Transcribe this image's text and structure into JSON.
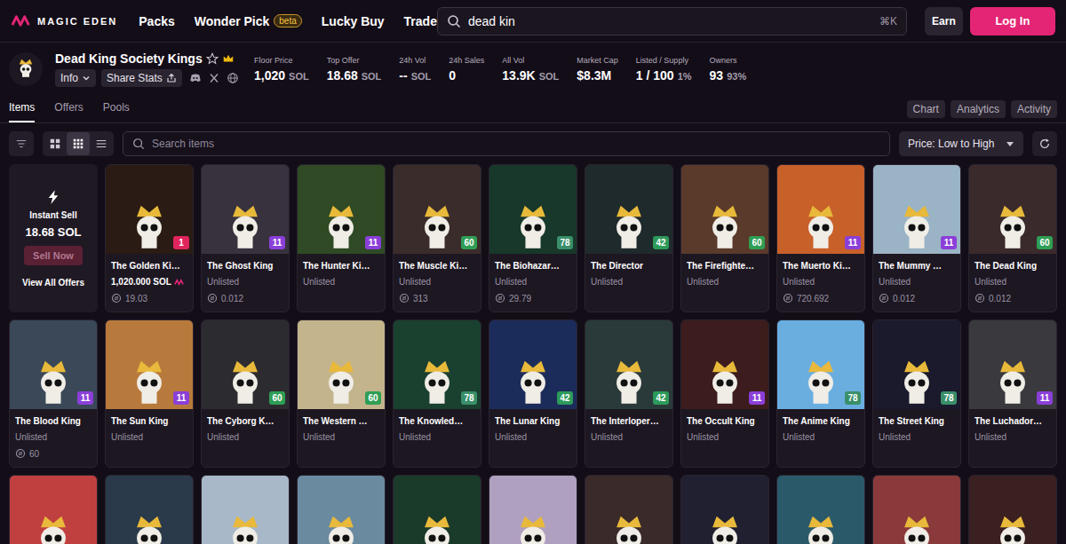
{
  "nav": {
    "logo": "MAGIC EDEN",
    "links": [
      {
        "label": "Packs",
        "badge": null
      },
      {
        "label": "Wonder Pick",
        "badge": "beta"
      },
      {
        "label": "Lucky Buy",
        "badge": null
      },
      {
        "label": "Trade",
        "badge": null
      }
    ]
  },
  "search": {
    "value": "dead kin",
    "shortcut": "⌘K"
  },
  "account": {
    "earn": "Earn",
    "login": "Log In"
  },
  "collection": {
    "name": "Dead King Society Kings",
    "favorited": false,
    "info": "Info",
    "share": "Share Stats",
    "stats": [
      {
        "label": "Floor Price",
        "value": "1,020",
        "unit": "SOL"
      },
      {
        "label": "Top Offer",
        "value": "18.68",
        "unit": "SOL"
      },
      {
        "label": "24h Vol",
        "value": "--",
        "unit": "SOL"
      },
      {
        "label": "24h Sales",
        "value": "0",
        "unit": ""
      },
      {
        "label": "All Vol",
        "value": "13.9K",
        "unit": "SOL"
      },
      {
        "label": "Market Cap",
        "value": "$8.3M",
        "unit": ""
      },
      {
        "label": "Listed / Supply",
        "value": "1 / 100",
        "unit": "1%"
      },
      {
        "label": "Owners",
        "value": "93",
        "unit": "93%"
      }
    ]
  },
  "tabs": [
    {
      "label": "Items",
      "selected": true
    },
    {
      "label": "Offers",
      "selected": false
    },
    {
      "label": "Pools",
      "selected": false
    }
  ],
  "side_buttons": [
    "Chart",
    "Analytics",
    "Activity"
  ],
  "toolbar": {
    "views": [
      {
        "kind": "large",
        "selected": false
      },
      {
        "kind": "small",
        "selected": true
      },
      {
        "kind": "list",
        "selected": false
      }
    ],
    "placeholder": "Search items",
    "sort": "Price: Low to High"
  },
  "instant_sell": {
    "title": "Instant Sell",
    "price": "18.68 SOL",
    "button": "Sell Now",
    "disabled": true,
    "link": "View All Offers"
  },
  "cards": [
    {
      "name": "The Golden Ki…",
      "badge": "1",
      "badge_color": "#e0245e",
      "price": "1,020.000 SOL",
      "listed": true,
      "last_sale": "19.03",
      "color": "#2a1c14"
    },
    {
      "name": "The Ghost King",
      "badge": "11",
      "badge_color": "#8b3fd9",
      "price": "Unlisted",
      "listed": false,
      "last_sale": "0.012",
      "color": "#38323f"
    },
    {
      "name": "The Hunter Ki…",
      "badge": "11",
      "badge_color": "#8b3fd9",
      "price": "Unlisted",
      "listed": false,
      "last_sale": null,
      "color": "#2f4a24"
    },
    {
      "name": "The Muscle Ki…",
      "badge": "60",
      "badge_color": "#2f9e55",
      "price": "Unlisted",
      "listed": false,
      "last_sale": "313",
      "color": "#3a2c2a"
    },
    {
      "name": "The Biohazar…",
      "badge": "78",
      "badge_color": "#3a8f6a",
      "price": "Unlisted",
      "listed": false,
      "last_sale": "29.79",
      "color": "#17382a"
    },
    {
      "name": "The Director",
      "badge": "42",
      "badge_color": "#2d9a5a",
      "price": "Unlisted",
      "listed": false,
      "last_sale": null,
      "color": "#1f2a2c"
    },
    {
      "name": "The Firefighte…",
      "badge": "60",
      "badge_color": "#2f9e55",
      "price": "Unlisted",
      "listed": false,
      "last_sale": null,
      "color": "#5a3a2a"
    },
    {
      "name": "The Muerto Ki…",
      "badge": "11",
      "badge_color": "#8b3fd9",
      "price": "Unlisted",
      "listed": false,
      "last_sale": "720.692",
      "color": "#c8602a"
    },
    {
      "name": "The Mummy …",
      "badge": "11",
      "badge_color": "#8b3fd9",
      "price": "Unlisted",
      "listed": false,
      "last_sale": "0.012",
      "color": "#9ab4c6"
    },
    {
      "name": "The Dead King",
      "badge": "60",
      "badge_color": "#2f9e55",
      "price": "Unlisted",
      "listed": false,
      "last_sale": "0.012",
      "color": "#3a2a2c"
    },
    {
      "name": "The Blood King",
      "badge": "11",
      "badge_color": "#8b3fd9",
      "price": "Unlisted",
      "listed": false,
      "last_sale": "60",
      "color": "#3a4858"
    },
    {
      "name": "The Sun King",
      "badge": "11",
      "badge_color": "#8b3fd9",
      "price": "Unlisted",
      "listed": false,
      "last_sale": null,
      "color": "#b87a3c"
    },
    {
      "name": "The Cyborg K…",
      "badge": "60",
      "badge_color": "#2f9e55",
      "price": "Unlisted",
      "listed": false,
      "last_sale": null,
      "color": "#2c2c30"
    },
    {
      "name": "The Western …",
      "badge": "60",
      "badge_color": "#2f9e55",
      "price": "Unlisted",
      "listed": false,
      "last_sale": null,
      "color": "#c4b48c"
    },
    {
      "name": "The Knowled…",
      "badge": "78",
      "badge_color": "#3a8f6a",
      "price": "Unlisted",
      "listed": false,
      "last_sale": null,
      "color": "#1a4030"
    },
    {
      "name": "The Lunar King",
      "badge": "42",
      "badge_color": "#2d9a5a",
      "price": "Unlisted",
      "listed": false,
      "last_sale": null,
      "color": "#1c2c5a"
    },
    {
      "name": "The Interloper…",
      "badge": "42",
      "badge_color": "#2d9a5a",
      "price": "Unlisted",
      "listed": false,
      "last_sale": null,
      "color": "#2a3a3a"
    },
    {
      "name": "The Occult King",
      "badge": "11",
      "badge_color": "#8b3fd9",
      "price": "Unlisted",
      "listed": false,
      "last_sale": null,
      "color": "#3c1c1c"
    },
    {
      "name": "The Anime King",
      "badge": "78",
      "badge_color": "#3a8f6a",
      "price": "Unlisted",
      "listed": false,
      "last_sale": null,
      "color": "#6aaee0"
    },
    {
      "name": "The Street King",
      "badge": "78",
      "badge_color": "#3a8f6a",
      "price": "Unlisted",
      "listed": false,
      "last_sale": null,
      "color": "#1a1a2c"
    },
    {
      "name": "The Luchador…",
      "badge": "11",
      "badge_color": "#8b3fd9",
      "price": "Unlisted",
      "listed": false,
      "last_sale": null,
      "color": "#3a3a3e"
    }
  ],
  "more_cards": [
    {
      "color": "#c04040"
    },
    {
      "color": "#2a3a4a"
    },
    {
      "color": "#a8b8c8"
    },
    {
      "color": "#6a8aa0"
    },
    {
      "color": "#1a3a2a"
    },
    {
      "color": "#b0a0c0"
    },
    {
      "color": "#3a2a2a"
    },
    {
      "color": "#202030"
    },
    {
      "color": "#2a5a6a"
    },
    {
      "color": "#8a3a3a"
    },
    {
      "color": "#3a2020"
    }
  ]
}
